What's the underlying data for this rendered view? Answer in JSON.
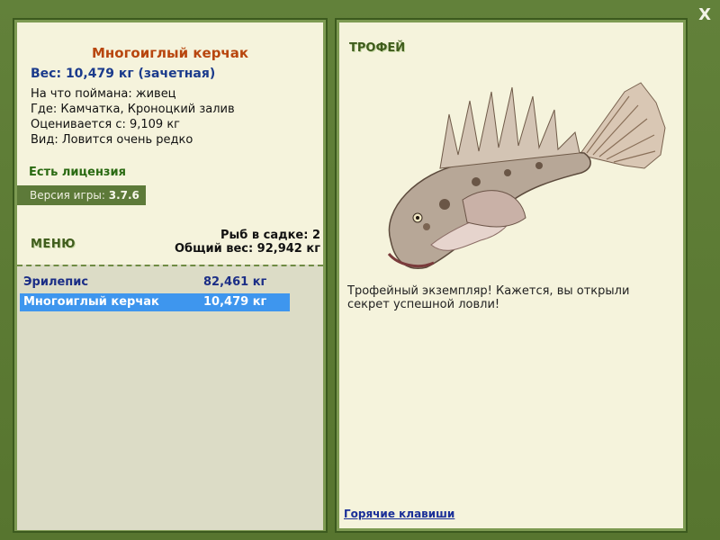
{
  "window": {
    "close_label": "X"
  },
  "fish": {
    "name": "Многоиглый керчак",
    "weight_line": "Вес: 10,479 кг (зачетная)",
    "details": [
      "На что поймана: живец",
      "Где: Камчатка, Кроноцкий залив",
      "Оценивается с: 9,109 кг",
      "Вид: Ловится очень редко"
    ]
  },
  "license_text": "Есть лицензия",
  "version": {
    "label": "Версия игры:",
    "value": "3.7.6"
  },
  "menu_label": "МЕНЮ",
  "catch_summary": {
    "count_line": "Рыб в садке: 2",
    "total_line": "Общий вес: 92,942 кг"
  },
  "catch_list": [
    {
      "name": "Эрилепис",
      "weight": "82,461 кг",
      "selected": false
    },
    {
      "name": "Многоиглый керчак",
      "weight": "10,479 кг",
      "selected": true
    }
  ],
  "trophy": {
    "label": "ТРОФЕЙ",
    "description": "Трофейный экземпляр! Кажется, вы открыли секрет успешной ловли!"
  },
  "hotkeys_label": "Горячие клавиши",
  "colors": {
    "frame_green": "#5b7a35",
    "panel_bg": "#f5f3dc",
    "title_orange": "#b8460e",
    "weight_blue": "#1b3b8c",
    "selected_row": "#3e96ee"
  }
}
